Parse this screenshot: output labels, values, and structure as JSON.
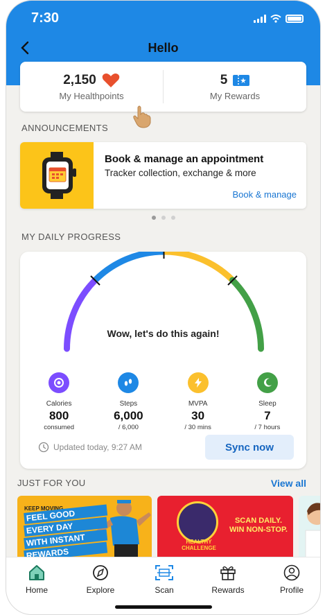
{
  "status_bar": {
    "time": "7:30"
  },
  "header": {
    "title": "Hello"
  },
  "points": {
    "healthpoints_value": "2,150",
    "healthpoints_label": "My Healthpoints",
    "rewards_value": "5",
    "rewards_label": "My Rewards"
  },
  "announcements": {
    "section_label": "ANNOUNCEMENTS",
    "title": "Book & manage an appointment",
    "subtitle": "Tracker collection, exchange & more",
    "link": "Book & manage",
    "dots_count": 3,
    "active_dot": 0
  },
  "progress": {
    "section_label": "MY DAILY PROGRESS",
    "message": "Wow, let's do this again!",
    "gauge_colors": [
      "#7c4dff",
      "#1e88e5",
      "#fbc02d",
      "#43a047"
    ],
    "metrics": [
      {
        "label": "Calories",
        "value": "800",
        "sub": "consumed",
        "icon": "plate-icon",
        "color": "#7c4dff"
      },
      {
        "label": "Steps",
        "value": "6,000",
        "sub": "/ 6,000",
        "icon": "footsteps-icon",
        "color": "#1e88e5"
      },
      {
        "label": "MVPA",
        "value": "30",
        "sub": "/ 30 mins",
        "icon": "lightning-icon",
        "color": "#fbc02d"
      },
      {
        "label": "Sleep",
        "value": "7",
        "sub": "/ 7 hours",
        "icon": "moon-icon",
        "color": "#43a047"
      }
    ],
    "updated": "Updated today, 9:27 AM",
    "sync_button": "Sync now"
  },
  "just_for_you": {
    "section_label": "JUST FOR YOU",
    "view_all": "View all",
    "promo1": {
      "tag": "KEEP MOVING",
      "lines": [
        "FEEL GOOD",
        "EVERY DAY",
        "WITH INSTANT",
        "REWARDS"
      ]
    },
    "promo2": {
      "text": "SCAN DAILY. WIN NON-STOP.",
      "badge_label": "HEALTHY CHALLENGE"
    }
  },
  "tabs": [
    {
      "label": "Home",
      "icon": "home-icon"
    },
    {
      "label": "Explore",
      "icon": "compass-icon"
    },
    {
      "label": "Scan",
      "icon": "scan-icon"
    },
    {
      "label": "Rewards",
      "icon": "gift-icon"
    },
    {
      "label": "Profile",
      "icon": "profile-icon"
    }
  ]
}
